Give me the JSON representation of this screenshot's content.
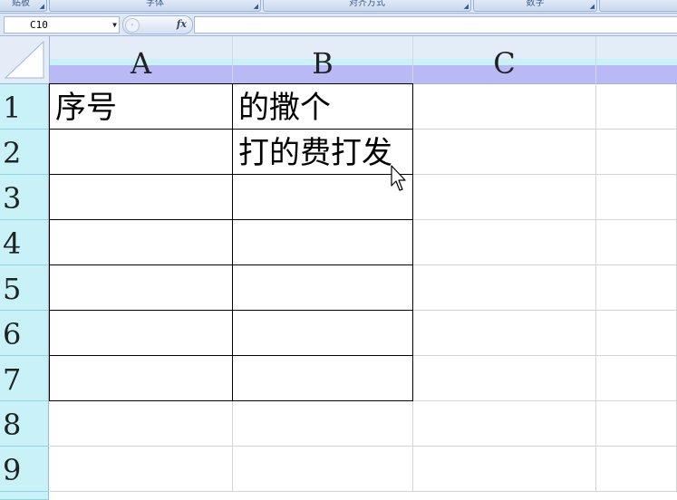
{
  "ribbon": {
    "groups": [
      "贴板",
      "字体",
      "对齐方式",
      "数字",
      "样"
    ]
  },
  "formula_bar": {
    "name_box": "C10",
    "fx_label": "fx",
    "formula": ""
  },
  "columns": [
    "A",
    "B",
    "C"
  ],
  "rows": [
    "1",
    "2",
    "3",
    "4",
    "5",
    "6",
    "7",
    "8",
    "9"
  ],
  "cells": {
    "A1": "序号",
    "B1": "的撒个",
    "B2": "打的费打发"
  }
}
